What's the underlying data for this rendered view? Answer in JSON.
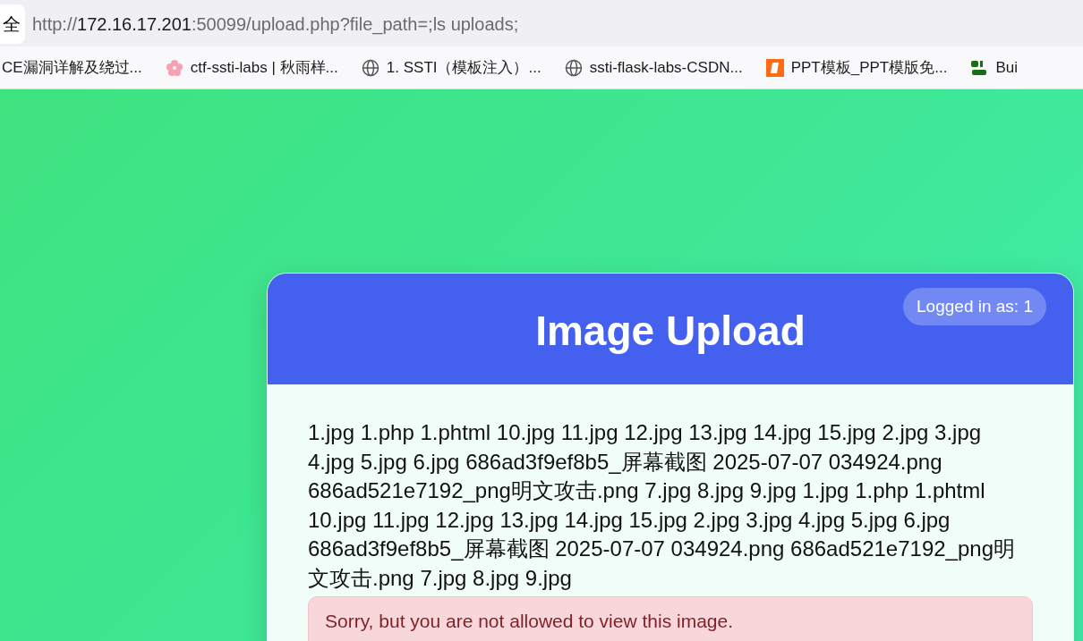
{
  "browser": {
    "side_button": "全",
    "url": {
      "scheme": "http://",
      "host": "172.16.17.201",
      "rest": ":50099/upload.php?file_path=;ls uploads;"
    },
    "bookmarks": [
      {
        "kind": "none",
        "label": "CE漏洞详解及绕过..."
      },
      {
        "kind": "flower",
        "label": "ctf-ssti-labs | 秋雨样..."
      },
      {
        "kind": "globe",
        "label": "1. SSTI（模板注入）..."
      },
      {
        "kind": "globe",
        "label": "ssti-flask-labs-CSDN..."
      },
      {
        "kind": "ppt",
        "label": "PPT模板_PPT模版免..."
      },
      {
        "kind": "builtwith",
        "label": "Bui"
      }
    ]
  },
  "card": {
    "title": "Image Upload",
    "user_badge": "Logged in as: 1",
    "listing": "1.jpg 1.php 1.phtml 10.jpg 11.jpg 12.jpg 13.jpg 14.jpg 15.jpg 2.jpg 3.jpg 4.jpg 5.jpg 6.jpg 686ad3f9ef8b5_屏幕截图 2025-07-07 034924.png 686ad521e7192_png明文攻击.png 7.jpg 8.jpg 9.jpg 1.jpg 1.php 1.phtml 10.jpg 11.jpg 12.jpg 13.jpg 14.jpg 15.jpg 2.jpg 3.jpg 4.jpg 5.jpg 6.jpg 686ad3f9ef8b5_屏幕截图 2025-07-07 034924.png 686ad521e7192_png明文攻击.png 7.jpg 8.jpg 9.jpg",
    "error": "Sorry, but you are not allowed to view this image."
  }
}
